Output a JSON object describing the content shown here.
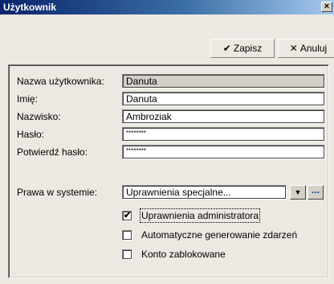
{
  "window": {
    "title": "Użytkownik",
    "close_glyph": "×"
  },
  "toolbar": {
    "save_label": "Zapisz",
    "save_icon": "✔",
    "cancel_label": "Anuluj",
    "cancel_icon": "✕"
  },
  "form": {
    "username_label": "Nazwa użytkownika:",
    "username_value": "Danuta",
    "firstname_label": "Imię:",
    "firstname_value": "Danuta",
    "lastname_label": "Nazwisko:",
    "lastname_value": "Ambroziak",
    "password_label": "Hasło:",
    "password_value": "********",
    "confirm_label": "Potwierdź hasło:",
    "confirm_value": "********",
    "rights_label": "Prawa w systemie:",
    "rights_value": "Uprawnienia specjalne...",
    "rights_dropdown_icon": "▼",
    "rights_more_icon": "...",
    "checkboxes": [
      {
        "label": "Uprawnienia administratora",
        "checked": true,
        "mark": "✔"
      },
      {
        "label": "Automatyczne generowanie zdarzeń",
        "checked": false,
        "mark": ""
      },
      {
        "label": "Konto zablokowane",
        "checked": false,
        "mark": ""
      }
    ]
  },
  "colors": {
    "titlebar_start": "#0a246a",
    "titlebar_end": "#a6caf0",
    "dialog_bg": "#ece9e2",
    "readonly_bg": "#d4d0c8"
  }
}
